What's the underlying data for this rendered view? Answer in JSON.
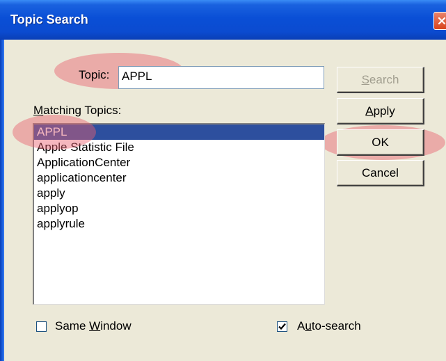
{
  "dialog": {
    "title": "Topic Search",
    "close_icon": "close-icon"
  },
  "topic": {
    "label": "Topic:",
    "value": "APPL"
  },
  "matching": {
    "label": "Matching Topics:",
    "items": [
      "APPL",
      "Apple Statistic File",
      "ApplicationCenter",
      "applicationcenter",
      "apply",
      "applyop",
      "applyrule"
    ],
    "selected_index": 0
  },
  "buttons": {
    "search": "Search",
    "apply": "Apply",
    "ok": "OK",
    "cancel": "Cancel"
  },
  "options": {
    "same_window": {
      "label": "Same Window",
      "checked": false
    },
    "auto_search": {
      "label": "Auto-search",
      "checked": true
    }
  },
  "annotation_color": "#e8606e"
}
